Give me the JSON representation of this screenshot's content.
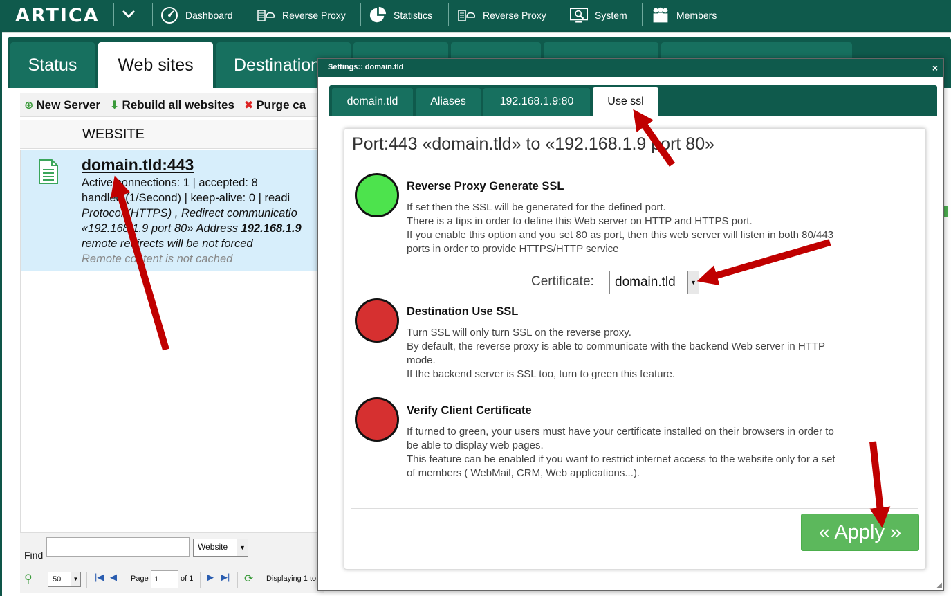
{
  "topbar": {
    "logo": "ARTICA",
    "items": [
      {
        "label": "Dashboard",
        "icon": "dashboard-icon"
      },
      {
        "label": "Reverse Proxy",
        "icon": "reverse-proxy-icon"
      },
      {
        "label": "Statistics",
        "icon": "statistics-icon"
      },
      {
        "label": "Reverse Proxy",
        "icon": "reverse-proxy-icon"
      },
      {
        "label": "System",
        "icon": "system-icon"
      },
      {
        "label": "Members",
        "icon": "members-icon"
      }
    ]
  },
  "main_tabs": [
    {
      "label": "Status",
      "active": false
    },
    {
      "label": "Web sites",
      "active": true
    },
    {
      "label": "Destinations",
      "active": false
    }
  ],
  "toolbar": {
    "new_server": "New Server",
    "rebuild": "Rebuild all websites",
    "purge": "Purge ca"
  },
  "grid": {
    "column_header": "WEBSITE",
    "row": {
      "site": "domain.tld:443",
      "line1": "Active connections: 1 | accepted: 8",
      "line2": "handled (1/Second) | keep-alive: 0 | readi",
      "line3": "Protocol (HTTPS) , Redirect communicatio",
      "line4_a": "«192.168.1.9 port 80» Address ",
      "line4_b": "192.168.1.9",
      "line5": "remote redirects will be not forced",
      "line6": "Remote content is not cached"
    }
  },
  "find": {
    "label": "Find",
    "value": "",
    "field_select": "Website"
  },
  "pager": {
    "per_page": "50",
    "page_label": "Page",
    "page_value": "1",
    "of_label": "of 1",
    "displaying": "Displaying 1 to"
  },
  "modal": {
    "title": "Settings:: domain.tld",
    "close": "×",
    "tabs": [
      {
        "label": "domain.tld",
        "active": false
      },
      {
        "label": "Aliases",
        "active": false
      },
      {
        "label": "192.168.1.9:80",
        "active": false
      },
      {
        "label": "Use ssl",
        "active": true
      }
    ],
    "panel_title": "Port:443 «domain.tld» to «192.168.1.9 port 80»",
    "options": [
      {
        "title": "Reverse Proxy Generate SSL",
        "state": "green",
        "desc1": "If set then the SSL will be generated for the defined port.",
        "desc2": "There is a tips in order to define this Web server on HTTP and HTTPS port.",
        "desc3": "If you enable this option and you set 80 as port, then this web server will listen in both 80/443 ports in order to provide HTTPS/HTTP service"
      },
      {
        "title": "Destination Use SSL",
        "state": "red",
        "desc1": "Turn SSL will only turn SSL on the reverse proxy.",
        "desc2": "By default, the reverse proxy is able to communicate with the backend Web server in HTTP mode.",
        "desc3": "If the backend server is SSL too, turn to green this feature."
      },
      {
        "title": "Verify Client Certificate",
        "state": "red",
        "desc1": "If turned to green, your users must have your certificate installed on their browsers in order to be able to display web pages.",
        "desc2": "This feature can be enabled if you want to restrict internet access to the website only for a set of members ( WebMail, CRM, Web applications...)."
      }
    ],
    "certificate_label": "Certificate:",
    "certificate_value": "domain.tld",
    "apply_label": "« Apply »"
  },
  "colors": {
    "brand_dark": "#0f5a4c",
    "tab_green": "#17705f",
    "led_on": "#4de34d",
    "led_off": "#d63030",
    "apply_button": "#5cb85c",
    "annotation_arrow": "#c00000"
  }
}
